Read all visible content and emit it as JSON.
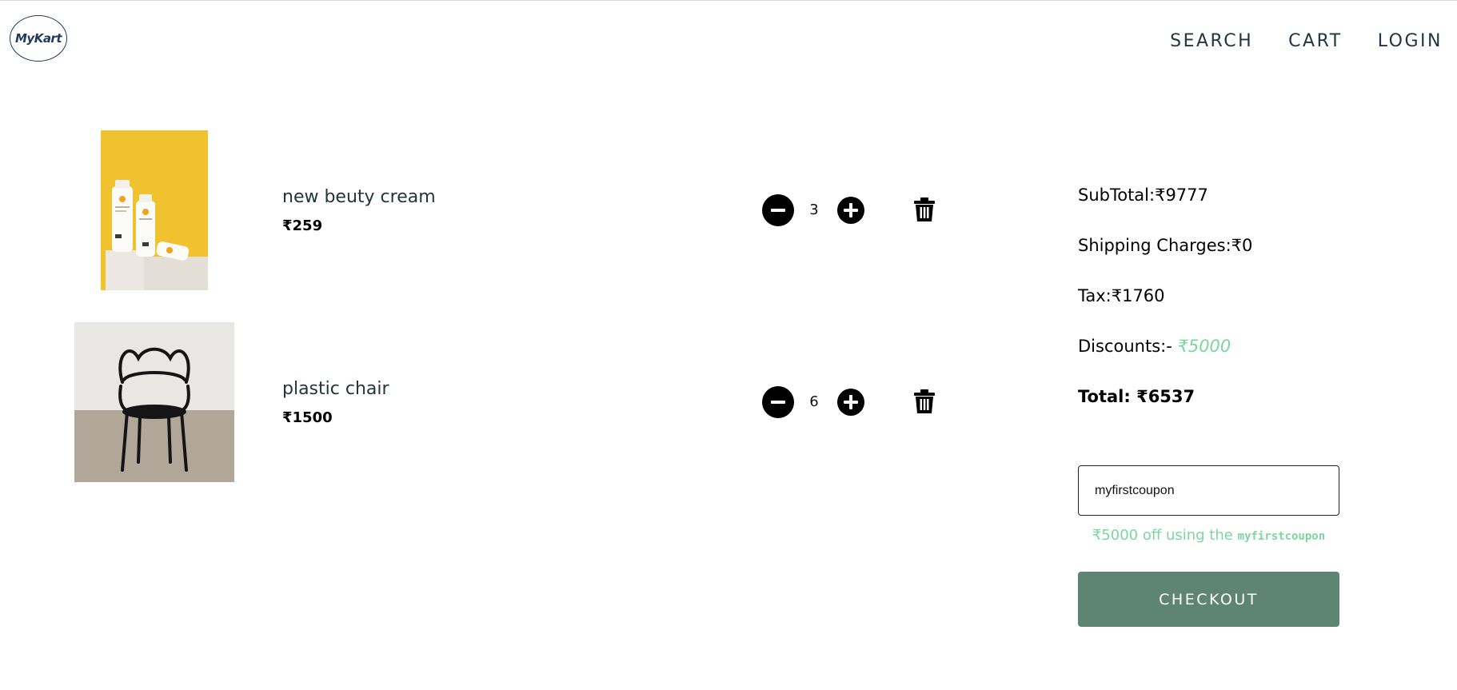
{
  "header": {
    "logo_text": "MyKart",
    "nav": [
      {
        "label": "SEARCH"
      },
      {
        "label": "CART"
      },
      {
        "label": "LOGIN"
      }
    ]
  },
  "cart": {
    "items": [
      {
        "name": "new beuty cream",
        "price": "₹259",
        "quantity": "3"
      },
      {
        "name": "plastic chair",
        "price": "₹1500",
        "quantity": "6"
      }
    ]
  },
  "summary": {
    "subtotal": "SubTotal:₹9777",
    "shipping": "Shipping Charges:₹0",
    "tax": "Tax:₹1760",
    "discount_label": "Discounts:- ",
    "discount_value": "₹5000",
    "total": "Total: ₹6537"
  },
  "coupon": {
    "value": "myfirstcoupon",
    "message_prefix": "₹5000 off using the ",
    "message_code": "myfirstcoupon"
  },
  "checkout": {
    "label": "CHECKOUT"
  },
  "colors": {
    "accent_green": "#7dd6a0",
    "checkout_bg": "#5e8574",
    "logo_navy": "#1f3a5c"
  }
}
